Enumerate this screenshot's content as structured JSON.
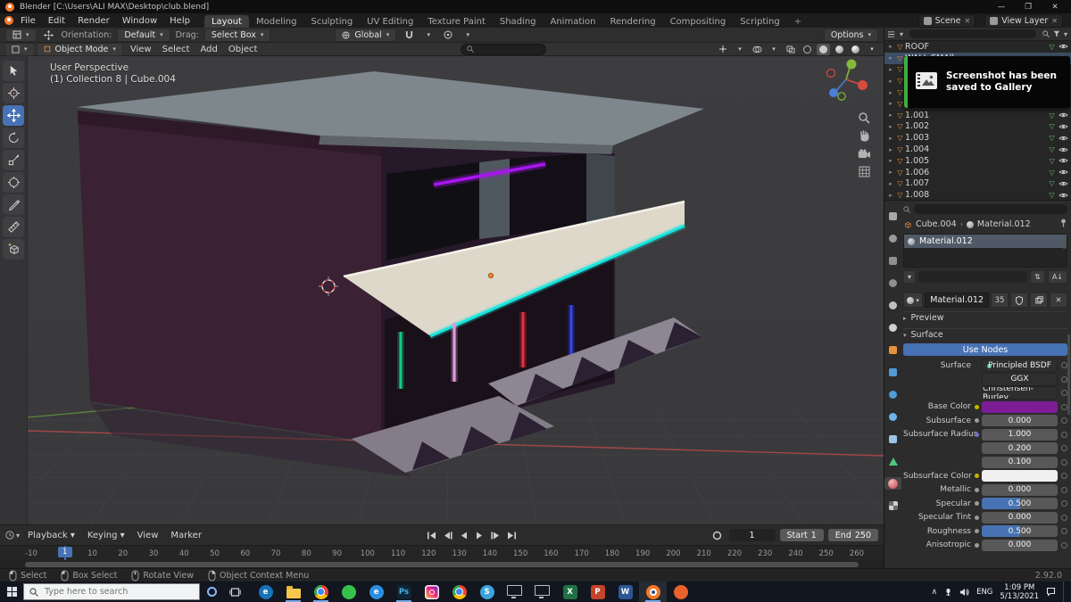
{
  "colors": {
    "accent": "#4772b3",
    "roof": "#7e878c",
    "wall": "#3a2133",
    "front": "#27182a",
    "ledge": "#ddd8ca",
    "neon_purple": "#a816ef",
    "neon_cyan": "#19e6de",
    "neon_green": "#13c87e",
    "neon_pink": "#e09ae0",
    "neon_red": "#e62e3c",
    "neon_blue": "#3346e6"
  },
  "title_bar": {
    "title": "Blender  [C:\\Users\\ALI MAX\\Desktop\\club.blend]",
    "minimize": "—",
    "maximize": "❐",
    "close": "✕"
  },
  "menu_bar": {
    "menus": [
      "File",
      "Edit",
      "Render",
      "Window",
      "Help"
    ],
    "workspaces": [
      "Layout",
      "Modeling",
      "Sculpting",
      "UV Editing",
      "Texture Paint",
      "Shading",
      "Animation",
      "Rendering",
      "Compositing",
      "Scripting"
    ],
    "active_workspace": "Layout",
    "add_tab": "+",
    "scene": "Scene",
    "view_layer": "View Layer"
  },
  "tool_settings": {
    "orientation_label": "Orientation:",
    "orientation": "Default",
    "drag_label": "Drag:",
    "drag": "Select Box",
    "transform_space": "Global",
    "options": "Options"
  },
  "view_header": {
    "mode": "Object Mode",
    "menus": [
      "View",
      "Select",
      "Add",
      "Object"
    ]
  },
  "toolbar_tools": [
    {
      "name": "select-box"
    },
    {
      "name": "cursor"
    },
    {
      "name": "move",
      "active": true
    },
    {
      "name": "rotate"
    },
    {
      "name": "scale"
    },
    {
      "name": "transform"
    },
    {
      "name": "annotate"
    },
    {
      "name": "measure"
    },
    {
      "name": "add-cube"
    }
  ],
  "viewport": {
    "overlay_line1": "User Perspective",
    "overlay_line2": "(1) Collection 8 | Cube.004"
  },
  "notification": {
    "text": "Screenshot has been saved to Gallery"
  },
  "outliner": {
    "items": [
      {
        "label": "ROOF"
      },
      {
        "label": "WALL SMAll",
        "selected": true
      },
      {
        "label": ""
      },
      {
        "label": ""
      },
      {
        "label": ""
      },
      {
        "label": ""
      },
      {
        "label": "1.001"
      },
      {
        "label": "1.002"
      },
      {
        "label": "1.003"
      },
      {
        "label": "1.004"
      },
      {
        "label": "1.005"
      },
      {
        "label": "1.006"
      },
      {
        "label": "1.007"
      },
      {
        "label": "1.008"
      }
    ]
  },
  "properties": {
    "breadcrumb_object": "Cube.004",
    "breadcrumb_material": "Material.012",
    "slot_name": "Material.012",
    "datablock_name": "Material.012",
    "users_count": "35",
    "preview_label": "Preview",
    "surface_label": "Surface",
    "use_nodes": "Use Nodes",
    "tabs": [
      {
        "name": "tool",
        "kind": "square",
        "color": "#a8a8a8"
      },
      {
        "name": "render",
        "kind": "circle",
        "color": "#9a9a9a"
      },
      {
        "name": "output",
        "kind": "square",
        "color": "#8f8f8f"
      },
      {
        "name": "view-layer",
        "kind": "circle",
        "color": "#8f8f8f"
      },
      {
        "name": "scene",
        "kind": "circle",
        "color": "#c0c0c0"
      },
      {
        "name": "world",
        "kind": "circle",
        "color": "#d0d0d0"
      },
      {
        "name": "object",
        "kind": "square",
        "color": "#e8913c"
      },
      {
        "name": "modifiers",
        "kind": "square",
        "color": "#4f9bd8"
      },
      {
        "name": "particles",
        "kind": "circle",
        "color": "#4f9bd8"
      },
      {
        "name": "physics",
        "kind": "circle",
        "color": "#6fb3e8"
      },
      {
        "name": "constraints",
        "kind": "square",
        "color": "#9fc3e0"
      },
      {
        "name": "object-data",
        "kind": "triangle",
        "color": "#4fc87f"
      },
      {
        "name": "material",
        "kind": "sphere",
        "active": true
      },
      {
        "name": "texture",
        "kind": "checker"
      }
    ],
    "rows": [
      {
        "label": "Surface",
        "type": "dropdown",
        "value": "Principled BSDF",
        "dot": "#66c29a"
      },
      {
        "label": "",
        "type": "dropdown",
        "value": "GGX"
      },
      {
        "label": "",
        "type": "dropdown",
        "value": "Christensen-Burley"
      },
      {
        "label": "Base Color",
        "type": "color",
        "color": "#7d1d96",
        "socket": "#c8b400"
      },
      {
        "label": "Subsurface",
        "type": "slider",
        "value": "0.000",
        "fill": 0,
        "socket": "#9a9a9a"
      },
      {
        "label": "Subsurface Radius",
        "type": "number",
        "value": "1.000",
        "socket": "#7070c8"
      },
      {
        "label": "",
        "type": "number",
        "value": "0.200"
      },
      {
        "label": "",
        "type": "number",
        "value": "0.100"
      },
      {
        "label": "Subsurface Color",
        "type": "color",
        "color": "#f0f0f0",
        "socket": "#c8b400"
      },
      {
        "label": "Metallic",
        "type": "slider",
        "value": "0.000",
        "fill": 0,
        "socket": "#9a9a9a"
      },
      {
        "label": "Specular",
        "type": "slider",
        "value": "0.500",
        "fill": 0.5,
        "socket": "#9a9a9a"
      },
      {
        "label": "Specular Tint",
        "type": "slider",
        "value": "0.000",
        "fill": 0,
        "socket": "#9a9a9a"
      },
      {
        "label": "Roughness",
        "type": "slider",
        "value": "0.500",
        "fill": 0.5,
        "socket": "#9a9a9a"
      },
      {
        "label": "Anisotropic",
        "type": "slider",
        "value": "0.000",
        "fill": 0,
        "socket": "#9a9a9a"
      }
    ]
  },
  "timeline": {
    "menus": [
      "Playback",
      "Keying",
      "View",
      "Marker"
    ],
    "current_frame": 1,
    "frame_field": "1",
    "start_label": "Start",
    "start_value": "1",
    "end_label": "End",
    "end_value": "250",
    "ticks": [
      -10,
      10,
      20,
      30,
      40,
      50,
      60,
      70,
      80,
      90,
      100,
      110,
      120,
      130,
      140,
      150,
      160,
      170,
      180,
      190,
      200,
      210,
      220,
      230,
      240,
      250,
      260
    ]
  },
  "status_bar": {
    "hints": [
      {
        "label": "Select",
        "button": "left"
      },
      {
        "label": "Box Select",
        "button": "left"
      },
      {
        "label": "Rotate View",
        "button": "middle"
      },
      {
        "label": "Object Context Menu",
        "button": "right"
      }
    ],
    "version": "2.92.0"
  },
  "taskbar": {
    "search_placeholder": "Type here to search",
    "apps": [
      {
        "name": "internet-explorer",
        "kind": "glyph-circle",
        "bg": "#1872b8",
        "glyph": "e"
      },
      {
        "name": "file-explorer",
        "kind": "folder",
        "open": true
      },
      {
        "name": "chrome",
        "kind": "chrome",
        "open": true
      },
      {
        "name": "whatsapp",
        "kind": "glyph-circle",
        "bg": "#35c24a",
        "glyph": ""
      },
      {
        "name": "edge",
        "kind": "glyph-circle",
        "bg": "#2a8fe0",
        "glyph": "e"
      },
      {
        "name": "photoshop",
        "kind": "glyph-square",
        "bg": "#0d2636",
        "fg": "#45b1e8",
        "glyph": "Ps",
        "open": true
      },
      {
        "name": "instagram",
        "kind": "instagram"
      },
      {
        "name": "chrome-profile-2",
        "kind": "chrome"
      },
      {
        "name": "skype",
        "kind": "glyph-circle",
        "bg": "#3aa5dc",
        "glyph": "S"
      },
      {
        "name": "remote-desktop",
        "kind": "monitor"
      },
      {
        "name": "remote-desktop-2",
        "kind": "monitor"
      },
      {
        "name": "excel",
        "kind": "glyph-square",
        "bg": "#1e7145",
        "fg": "#ffffff",
        "glyph": "X"
      },
      {
        "name": "powerpoint",
        "kind": "glyph-square",
        "bg": "#c4432b",
        "fg": "#ffffff",
        "glyph": "P"
      },
      {
        "name": "word",
        "kind": "glyph-square",
        "bg": "#2b5797",
        "fg": "#ffffff",
        "glyph": "W"
      },
      {
        "name": "blender",
        "kind": "blender",
        "open": true,
        "active": true
      },
      {
        "name": "firefox",
        "kind": "glyph-circle",
        "bg": "#e8622c",
        "glyph": ""
      }
    ],
    "tray": {
      "language": "ENG",
      "time": "1:09 PM",
      "date": "5/13/2021"
    }
  }
}
